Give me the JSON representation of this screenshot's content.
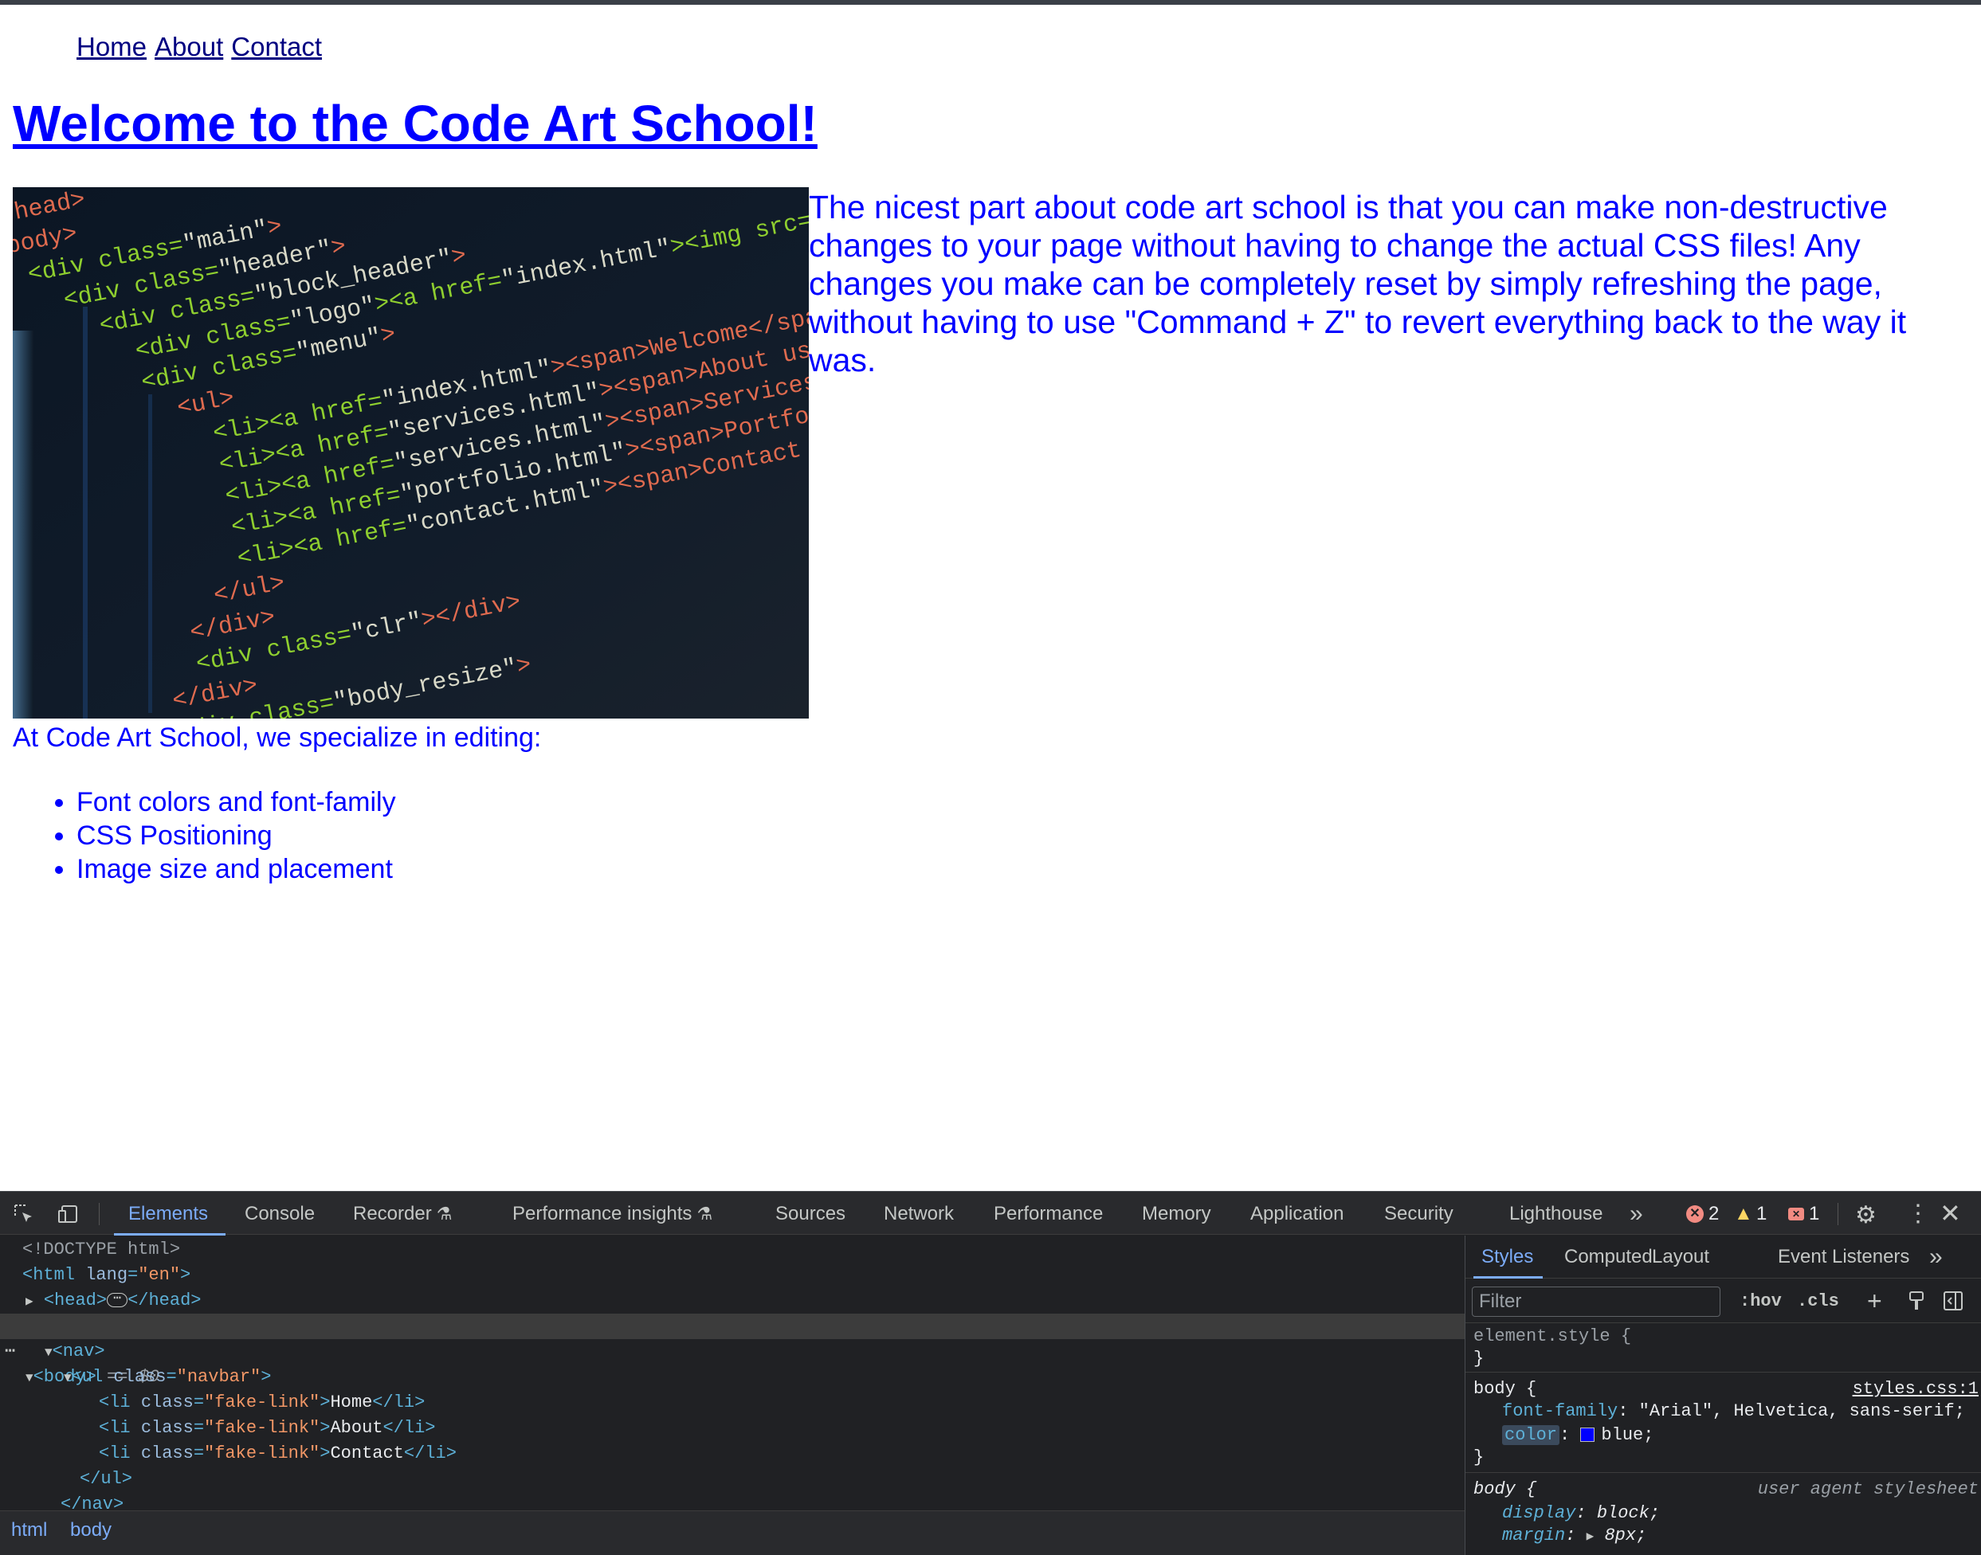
{
  "nav": {
    "home": "Home",
    "about": "About",
    "contact": "Contact"
  },
  "heading": "Welcome to the Code Art School!",
  "image": {
    "code_lines": [
      "</head>",
      "<body>",
      "<div class=\"main\">",
      "<div class=\"header\">",
      "<div class=\"block_header\">",
      "<div class=\"logo\"><a href=\"index.html\"><img src=\"images/logo.gif\"",
      "<div class=\"menu\">",
      "<ul>",
      "<li><a href=\"index.html\"><span>Welcome</span></a></li>",
      "<li><a href=\"services.html\"><span>About us</span></a></li>",
      "<li><a href=\"services.html\"><span>Services</span></a></li>",
      "<li><a href=\"portfolio.html\"><span>Portfolio</span></a></li>",
      "<li><a href=\"contact.html\"><span>Contact Us</span></a></li>",
      "</ul>",
      "</div>",
      "<div class=\"clr\"></div>",
      "</div>",
      "<div class=\"body_resize\">"
    ]
  },
  "intro": "The nicest part about code art school is that you can make non-destructive changes to your page without having to change the actual CSS files! Any changes you make can be completely reset by simply refreshing the page, without having to use \"Command + Z\" to revert everything back to the way it was.",
  "specialize": "At Code Art School, we specialize in editing:",
  "skills": [
    "Font colors and font-family",
    "CSS Positioning",
    "Image size and placement"
  ],
  "devtools": {
    "tabs": [
      "Elements",
      "Console",
      "Recorder",
      "Performance insights",
      "Sources",
      "Network",
      "Performance",
      "Memory",
      "Application",
      "Security",
      "Lighthouse"
    ],
    "active_tab": "Elements",
    "more": "»",
    "errors": "2",
    "warnings": "1",
    "issues": "1",
    "icons": [
      "inspect-icon",
      "device-toolbar-icon",
      "flask-icon",
      "error-icon",
      "warning-icon",
      "issue-icon",
      "gear-icon",
      "kebab-icon",
      "close-icon"
    ],
    "dom": {
      "doctype": "<!DOCTYPE html>",
      "html_open": "<html",
      "html_attr": "lang",
      "html_attr_val": "\"en\"",
      "html_close": ">",
      "head_open": "<head>",
      "head_close": "</head>",
      "ellipsis": "⋯",
      "body_tag": "<body>",
      "body_eq": " == ",
      "body_dollar": "$0",
      "row_dots": "⋯",
      "nav_open": "<nav>",
      "ul_open": "<ul",
      "class_attr": "class",
      "ul_class_val": "\"navbar\"",
      "gt": ">",
      "li_open": "<li",
      "li_class_val": "\"fake-link\"",
      "li_close": "</li>",
      "li_texts": [
        "Home",
        "About",
        "Contact"
      ],
      "ul_close": "</ul>",
      "nav_close": "</nav>"
    },
    "breadcrumbs": [
      "html",
      "body"
    ],
    "styles": {
      "tabs": [
        "Styles",
        "Computed",
        "Layout",
        "Event Listeners"
      ],
      "active_tab": "Styles",
      "more": "»",
      "filter_placeholder": "Filter",
      "hov": ":hov",
      "cls": ".cls",
      "plus": "+",
      "element_style": "element.style {",
      "close_brace": "}",
      "body_rule_selector": "body {",
      "body_rule_source": "styles.css:1",
      "font_family_prop": "font-family",
      "font_family_val": "\"Arial\", Helvetica, sans-serif;",
      "color_prop": "color",
      "color_val": "blue;",
      "swatch_color": "#0000ff",
      "ua_selector": "body {",
      "ua_source": "user agent stylesheet",
      "display_prop": "display",
      "display_val": "block;",
      "margin_prop": "margin",
      "margin_val": "8px;",
      "colon": ": "
    }
  },
  "colors": {
    "text_blue": "#0000ff",
    "nav_link": "#000080",
    "devtools_bg": "#202124",
    "devtools_accent": "#7cacf8"
  }
}
